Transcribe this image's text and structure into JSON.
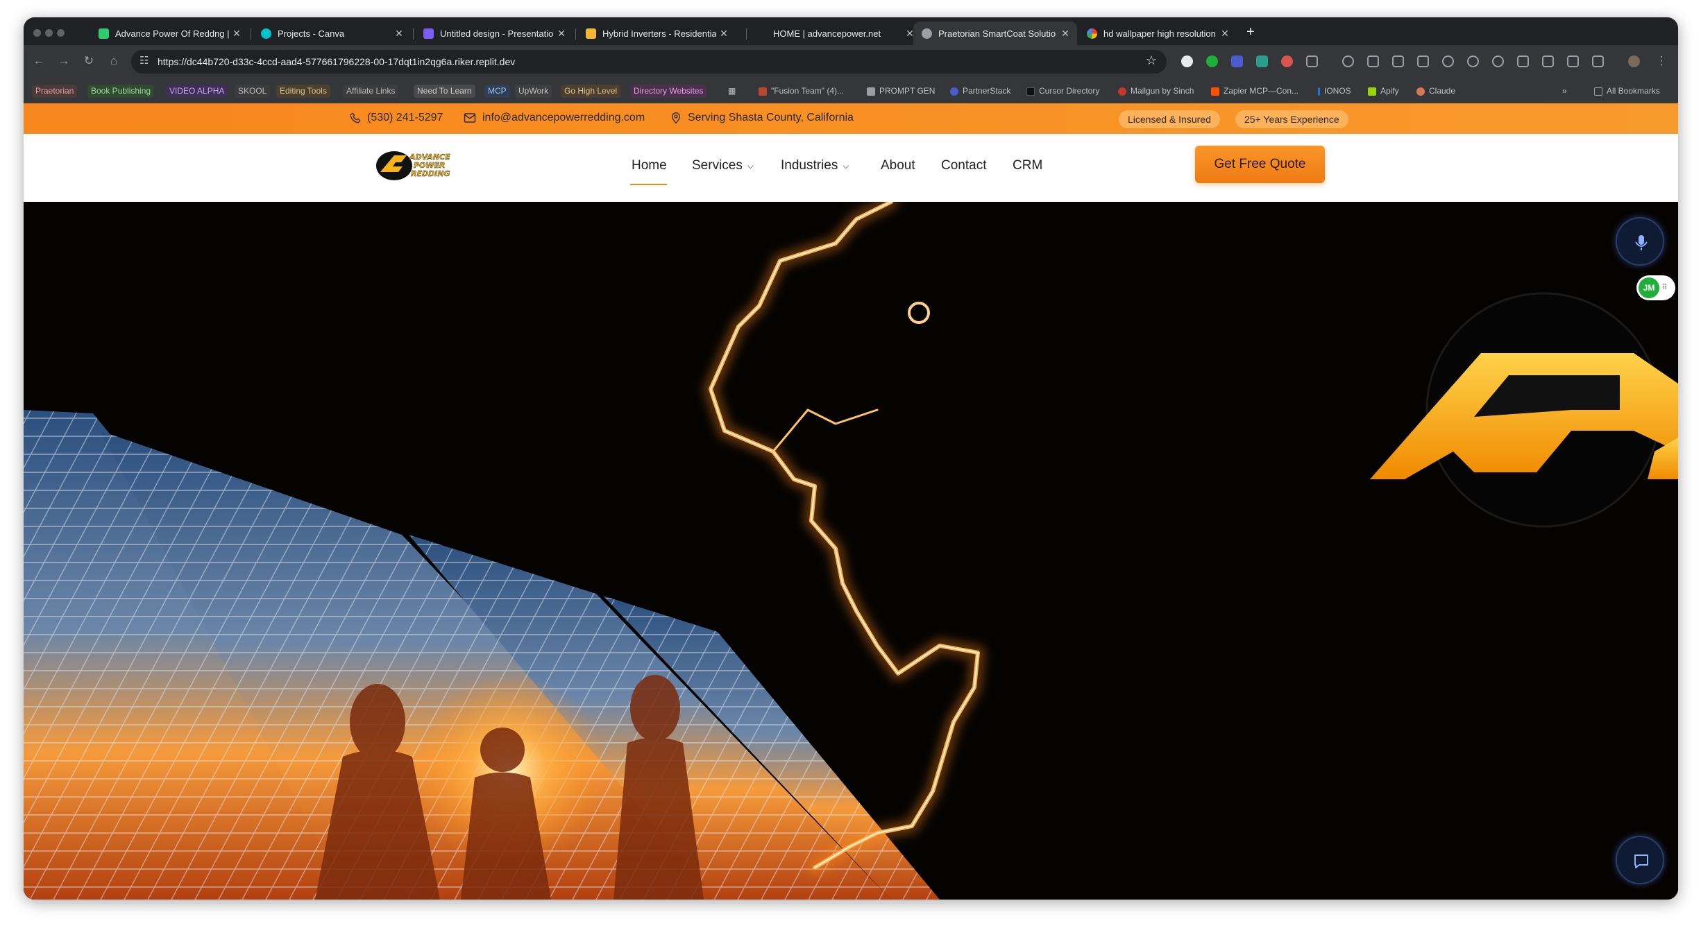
{
  "browser": {
    "tabs": [
      {
        "title": "Advance Power Of Reddng | P",
        "icon_color": "#2ecc71"
      },
      {
        "title": "Projects - Canva",
        "icon_color": "#00c4cc"
      },
      {
        "title": "Untitled design - Presentation",
        "icon_color": "#7b5cf5"
      },
      {
        "title": "Hybrid Inverters - Residential",
        "icon_color": "#f2b632"
      },
      {
        "title": "HOME | advancepower.net",
        "icon_color": ""
      },
      {
        "title": "Praetorian SmartCoat Solutio",
        "icon_color": "#9aa0a6"
      },
      {
        "title": "hd wallpaper high resolution",
        "icon_color": "#4285f4"
      }
    ],
    "active_tab_index": 5,
    "new_tab_label": "+",
    "url": "https://dc44b720-d33c-4ccd-aad4-577661796228-00-17dqt1in2qg6a.riker.replit.dev",
    "bookmarks_colored": [
      {
        "label": "Praetorian",
        "bg": "#4a3a3a",
        "fg": "#e8a0a0"
      },
      {
        "label": "Book Publishing",
        "bg": "#2f4a2f",
        "fg": "#9fd89f"
      },
      {
        "label": "VIDEO ALPHA",
        "bg": "#3d2f55",
        "fg": "#c9a8f2"
      },
      {
        "label": "SKOOL",
        "bg": "#3c3c3c",
        "fg": "#bdbdbd"
      },
      {
        "label": "Editing Tools",
        "bg": "#4a4030",
        "fg": "#d9c08a"
      },
      {
        "label": "Affiliate Links",
        "bg": "#3c3c3c",
        "fg": "#bdbdbd"
      },
      {
        "label": "Need To Learn",
        "bg": "#4a4a4a",
        "fg": "#cfcfcf"
      },
      {
        "label": "MCP",
        "bg": "#2f3f55",
        "fg": "#9fc2f2"
      },
      {
        "label": "UpWork",
        "bg": "#3f3f3f",
        "fg": "#c4c4c4"
      },
      {
        "label": "Go High Level",
        "bg": "#4a3f30",
        "fg": "#e0c58f"
      },
      {
        "label": "Directory Websites",
        "bg": "#4a304a",
        "fg": "#e0a0e0"
      }
    ],
    "bookmarks_plain": [
      {
        "label": "\"Fusion Team\" (4)...",
        "icon": "#b7482d"
      },
      {
        "label": "PROMPT GEN",
        "icon": "#9aa0a6"
      },
      {
        "label": "PartnerStack",
        "icon": "#4a5cd0"
      },
      {
        "label": "Cursor Directory",
        "icon": "#202124"
      },
      {
        "label": "Mailgun by Sinch",
        "icon": "#c0392b"
      },
      {
        "label": "Zapier MCP—Con...",
        "icon": "#ff4f00"
      },
      {
        "label": "IONOS",
        "icon": "#1a73e8"
      },
      {
        "label": "Apify",
        "icon": "#97d700"
      },
      {
        "label": "Claude",
        "icon": "#d97757"
      }
    ],
    "more_bookmarks": "»",
    "all_bookmarks": "All Bookmarks"
  },
  "site": {
    "phone": "(530) 241-5297",
    "email": "info@advancepowerredding.com",
    "location": "Serving Shasta County, California",
    "badge_licensed": "Licensed & Insured",
    "badge_experience": "25+ Years Experience",
    "logo_text_line1": "ADVANCE",
    "logo_text_line2": "POWER",
    "logo_text_line3": "REDDING",
    "nav": {
      "home": "Home",
      "services": "Services",
      "industries": "Industries",
      "about": "About",
      "contact": "Contact",
      "crm": "CRM"
    },
    "cta": "Get Free Quote",
    "jm_badge": "JM",
    "accent": "#f7861c"
  }
}
